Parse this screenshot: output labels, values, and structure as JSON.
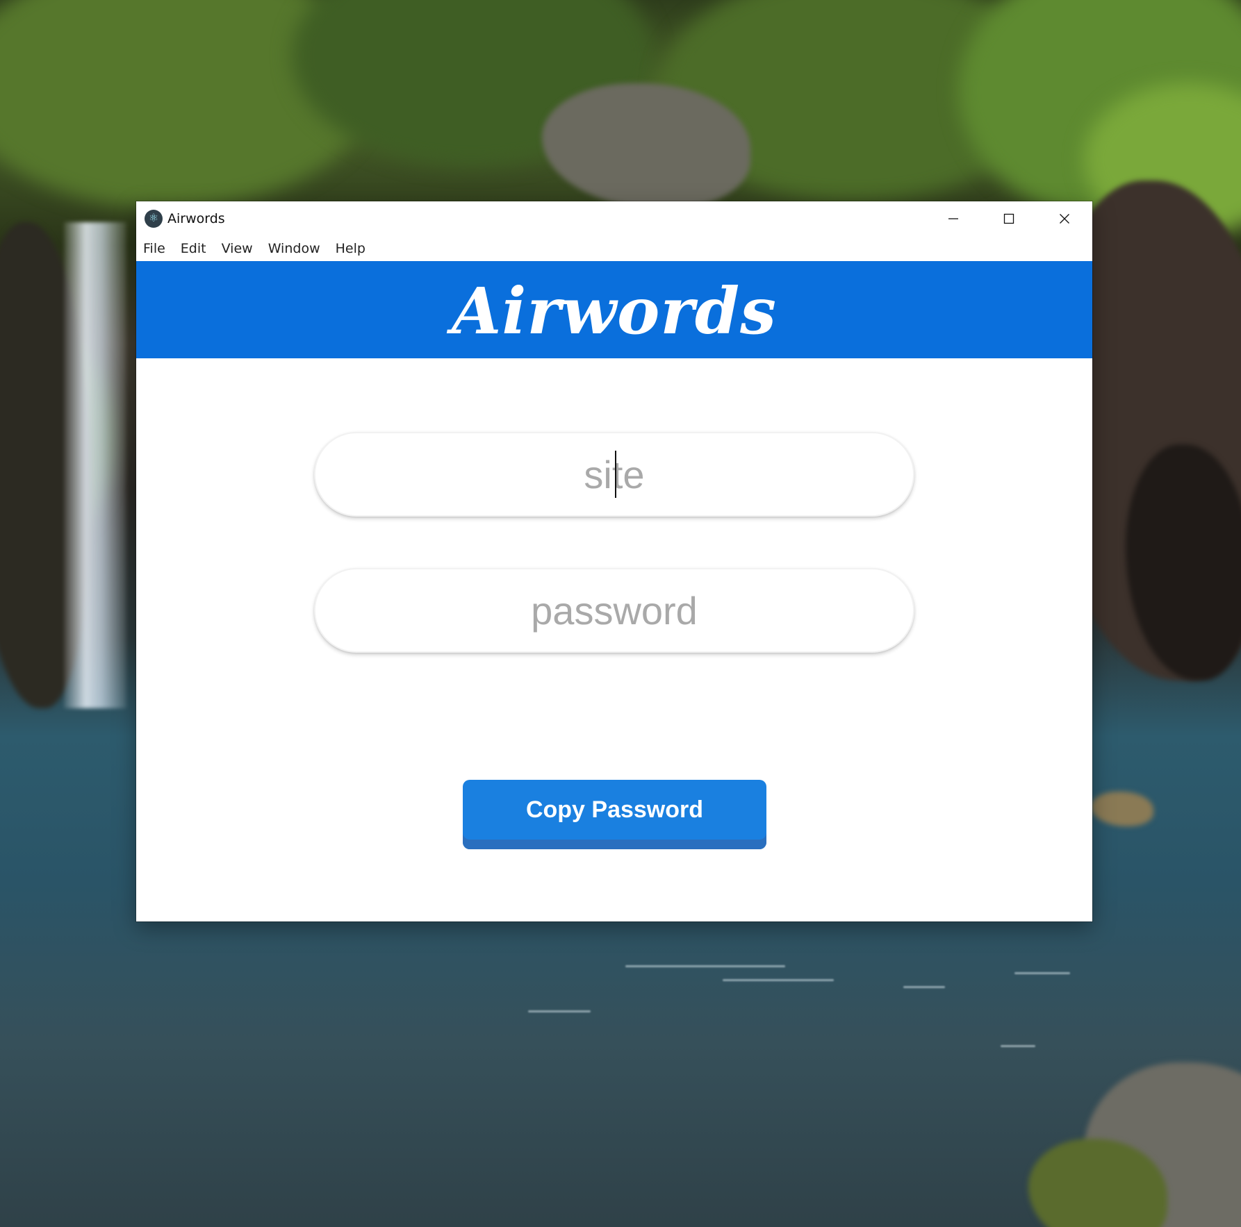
{
  "window": {
    "title": "Airwords",
    "controls": {
      "minimize": "minimize-icon",
      "maximize": "maximize-icon",
      "close": "close-icon"
    }
  },
  "menu": {
    "items": [
      {
        "label": "File"
      },
      {
        "label": "Edit"
      },
      {
        "label": "View"
      },
      {
        "label": "Window"
      },
      {
        "label": "Help"
      }
    ]
  },
  "header": {
    "title": "Airwords",
    "background_color": "#0a6fdc"
  },
  "form": {
    "site": {
      "value": "",
      "placeholder": "site",
      "focused": true
    },
    "password": {
      "value": "",
      "placeholder": "password"
    }
  },
  "actions": {
    "copy_label": "Copy Password",
    "button_color": "#1a80e0"
  }
}
